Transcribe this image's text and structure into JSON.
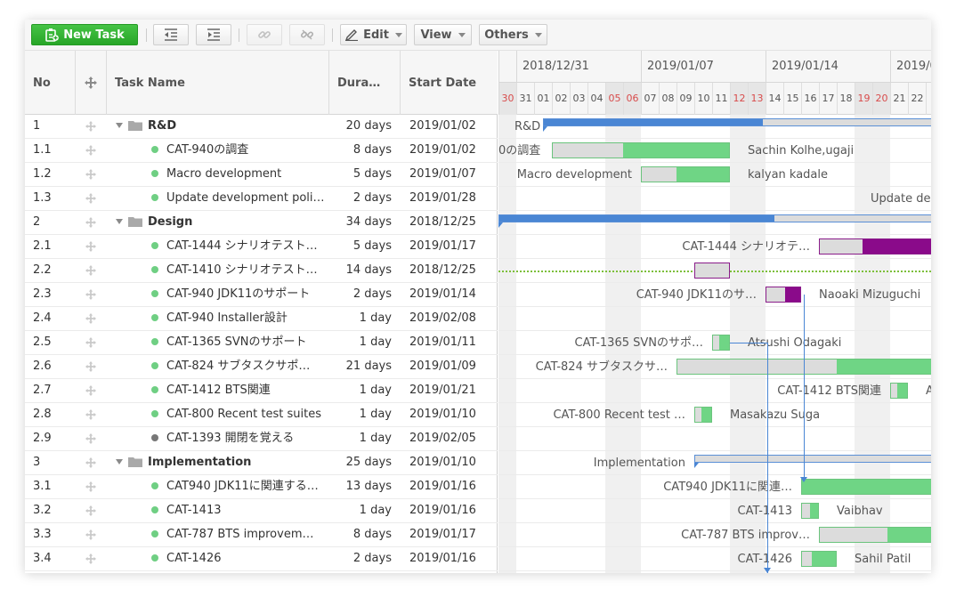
{
  "toolbar": {
    "new_task_label": "New Task",
    "edit_label": "Edit",
    "view_label": "View",
    "others_label": "Others"
  },
  "grid": {
    "columns": {
      "no": "No",
      "name": "Task Name",
      "duration": "Dura…",
      "start": "Start Date"
    },
    "rows": [
      {
        "no": "1",
        "name": "R&D",
        "duration": "20 days",
        "start": "2019/01/02",
        "type": "group"
      },
      {
        "no": "1.1",
        "name": "CAT-940の調査",
        "duration": "8 days",
        "start": "2019/01/02",
        "type": "task"
      },
      {
        "no": "1.2",
        "name": "Macro development",
        "duration": "5 days",
        "start": "2019/01/07",
        "type": "task"
      },
      {
        "no": "1.3",
        "name": "Update development poli…",
        "duration": "2 days",
        "start": "2019/01/28",
        "type": "task"
      },
      {
        "no": "2",
        "name": "Design",
        "duration": "34 days",
        "start": "2018/12/25",
        "type": "group"
      },
      {
        "no": "2.1",
        "name": "CAT-1444 シナリオテスト…",
        "duration": "5 days",
        "start": "2019/01/17",
        "type": "task"
      },
      {
        "no": "2.2",
        "name": "CAT-1410 シナリオテスト…",
        "duration": "14 days",
        "start": "2018/12/25",
        "type": "task"
      },
      {
        "no": "2.3",
        "name": "CAT-940 JDK11のサポート",
        "duration": "2 days",
        "start": "2019/01/14",
        "type": "task"
      },
      {
        "no": "2.4",
        "name": "CAT-940 Installer設計",
        "duration": "1 day",
        "start": "2019/02/08",
        "type": "task"
      },
      {
        "no": "2.5",
        "name": "CAT-1365 SVNのサポート",
        "duration": "1 day",
        "start": "2019/01/11",
        "type": "task"
      },
      {
        "no": "2.6",
        "name": "CAT-824 サブタスクサポ…",
        "duration": "21 days",
        "start": "2019/01/09",
        "type": "task"
      },
      {
        "no": "2.7",
        "name": "CAT-1412 BTS関連",
        "duration": "1 day",
        "start": "2019/01/21",
        "type": "task"
      },
      {
        "no": "2.8",
        "name": "CAT-800 Recent test suites",
        "duration": "1 day",
        "start": "2019/01/10",
        "type": "task"
      },
      {
        "no": "2.9",
        "name": "CAT-1393 開閉を覚える",
        "duration": "1 day",
        "start": "2019/02/05",
        "type": "task-grey"
      },
      {
        "no": "3",
        "name": "Implementation",
        "duration": "25 days",
        "start": "2019/01/10",
        "type": "group"
      },
      {
        "no": "3.1",
        "name": "CAT940 JDK11に関連する…",
        "duration": "13 days",
        "start": "2019/01/16",
        "type": "task"
      },
      {
        "no": "3.2",
        "name": "CAT-1413",
        "duration": "1 day",
        "start": "2019/01/16",
        "type": "task"
      },
      {
        "no": "3.3",
        "name": "CAT-787 BTS improvem…",
        "duration": "8 days",
        "start": "2019/01/17",
        "type": "task"
      },
      {
        "no": "3.4",
        "name": "CAT-1426",
        "duration": "2 days",
        "start": "2019/01/16",
        "type": "task"
      }
    ]
  },
  "timeline": {
    "weeks": [
      "2018/12/31",
      "2019/01/07",
      "2019/01/14",
      "2019/0"
    ],
    "days": [
      "30",
      "31",
      "01",
      "02",
      "03",
      "04",
      "05",
      "06",
      "07",
      "08",
      "09",
      "10",
      "11",
      "12",
      "13",
      "14",
      "15",
      "16",
      "17",
      "18",
      "19",
      "20",
      "21",
      "22",
      "2"
    ],
    "weekend_indices": [
      0,
      6,
      7,
      13,
      14,
      20,
      21
    ],
    "first_day": "2018/12/30",
    "colors": {
      "progress": "#6fd585",
      "group": "#4a86d4",
      "critical": "#8a0a8a",
      "weekend_text": "#d84b4b"
    },
    "rows": [
      {
        "left_label": "R&D",
        "kind": "group",
        "start": 2.5,
        "end": 25,
        "progress": 0.55
      },
      {
        "left_label": "0の調査",
        "right_label": "Sachin Kolhe,ugaji",
        "kind": "task",
        "start": 3,
        "end": 13,
        "progress": 0.4
      },
      {
        "left_label": "Macro development",
        "right_label": "kalyan kadale",
        "kind": "task",
        "start": 8,
        "end": 13,
        "progress": 0.4
      },
      {
        "right_label": "Update de",
        "kind": "none"
      },
      {
        "kind": "group",
        "start": 0,
        "end": 25,
        "progress": 0.62
      },
      {
        "left_label": "CAT-1444 シナリオテ…",
        "kind": "critical",
        "start": 18,
        "end": 25,
        "progress": 0.35
      },
      {
        "kind": "outline",
        "start": 11,
        "end": 13
      },
      {
        "left_label": "CAT-940 JDK11のサ…",
        "right_label": "Naoaki Mizuguchi",
        "kind": "critical",
        "start": 15,
        "end": 17,
        "progress": 0.55
      },
      {
        "kind": "none"
      },
      {
        "left_label": "CAT-1365 SVNのサポ…",
        "right_label": "Atsushi Odagaki",
        "kind": "task",
        "start": 12,
        "end": 13,
        "progress": 0.4
      },
      {
        "left_label": "CAT-824 サブタスクサ…",
        "kind": "task",
        "start": 10,
        "end": 25,
        "progress": 0.6
      },
      {
        "left_label": "CAT-1412 BTS関連",
        "right_label": "A",
        "kind": "task",
        "start": 22,
        "end": 23,
        "progress": 0.4
      },
      {
        "left_label": "CAT-800 Recent test …",
        "right_label": "Masakazu Suga",
        "kind": "task",
        "start": 11,
        "end": 12,
        "progress": 0.4
      },
      {
        "kind": "none"
      },
      {
        "left_label": "Implementation",
        "kind": "group",
        "start": 11,
        "end": 25,
        "progress": 0
      },
      {
        "left_label": "CAT940 JDK11に関連…",
        "kind": "task",
        "start": 17,
        "end": 25,
        "progress": 0
      },
      {
        "left_label": "CAT-1413",
        "right_label": "Vaibhav",
        "kind": "task",
        "start": 17,
        "end": 18,
        "progress": 0.5
      },
      {
        "left_label": "CAT-787 BTS improv…",
        "kind": "task",
        "start": 18,
        "end": 25,
        "progress": 0.55
      },
      {
        "left_label": "CAT-1426",
        "right_label": "Sahil Patil",
        "kind": "task",
        "start": 17,
        "end": 19,
        "progress": 0.3
      }
    ]
  }
}
